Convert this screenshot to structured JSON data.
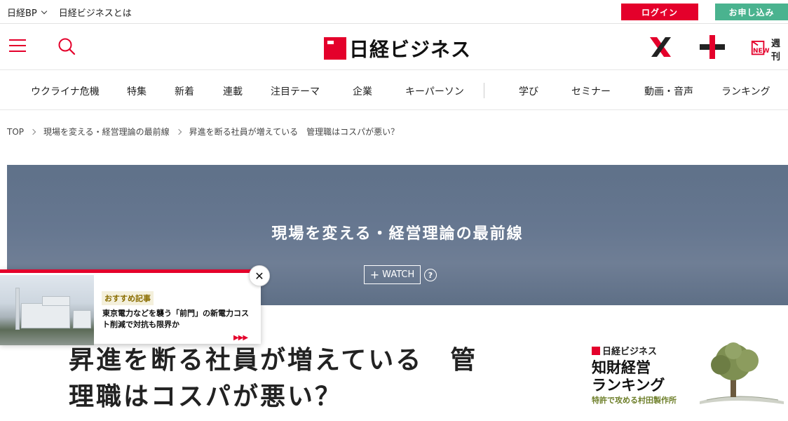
{
  "topbar": {
    "brand_menu": "日経BP",
    "about_link": "日経ビジネスとは",
    "login_label": "ログイン",
    "signup_label": "お申し込み"
  },
  "header": {
    "logo_text": "日経ビジネス",
    "weekly_label": "週刊",
    "weekly_badge": "NEW"
  },
  "nav": {
    "items": [
      "ウクライナ危機",
      "特集",
      "新着",
      "連載",
      "注目テーマ",
      "企業",
      "キーパーソン",
      "学び",
      "セミナー",
      "動画・音声",
      "ランキング"
    ]
  },
  "breadcrumb": [
    "TOP",
    "現場を変える・経営理論の最前線",
    "昇進を断る社員が増えている　管理職はコスパが悪い？"
  ],
  "hero": {
    "series_title": "現場を変える・経営理論の最前線",
    "watch_label": "WATCH",
    "help_glyph": "?"
  },
  "recommend": {
    "label": "おすすめ記事",
    "text": "東京電力などを襲う「前門」の新電力コスト削減で対抗も限界か",
    "arrows": "▶▶▶",
    "close_glyph": "✕"
  },
  "article": {
    "title_line1": "昇進を断る社員が増えている　管",
    "title_line2": "理職はコスパが悪い？"
  },
  "ad": {
    "logo_text": "日経ビジネス",
    "title_line1": "知財経営",
    "title_line2": "ランキング",
    "subtitle": "特許で攻める村田製作所"
  },
  "colors": {
    "brand_red": "#e4002b",
    "signup_green": "#4ab38f",
    "hero_bg": "#667790"
  }
}
